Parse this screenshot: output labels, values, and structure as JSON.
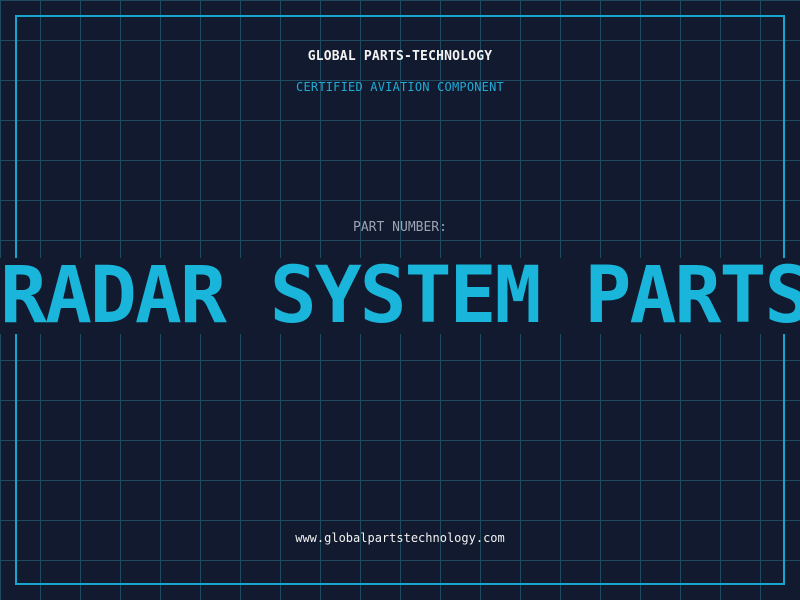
{
  "header": {
    "company": "GLOBAL PARTS-TECHNOLOGY",
    "subtitle": "CERTIFIED AVIATION COMPONENT"
  },
  "part": {
    "label": "PART NUMBER:",
    "value": "RADAR SYSTEM PARTS"
  },
  "footer": {
    "url": "www.globalpartstechnology.com"
  },
  "colors": {
    "background": "#111a2e",
    "grid": "#1f4a5f",
    "accent": "#19b5da",
    "text": "#f2f2f2",
    "muted": "#9aa4b4"
  }
}
